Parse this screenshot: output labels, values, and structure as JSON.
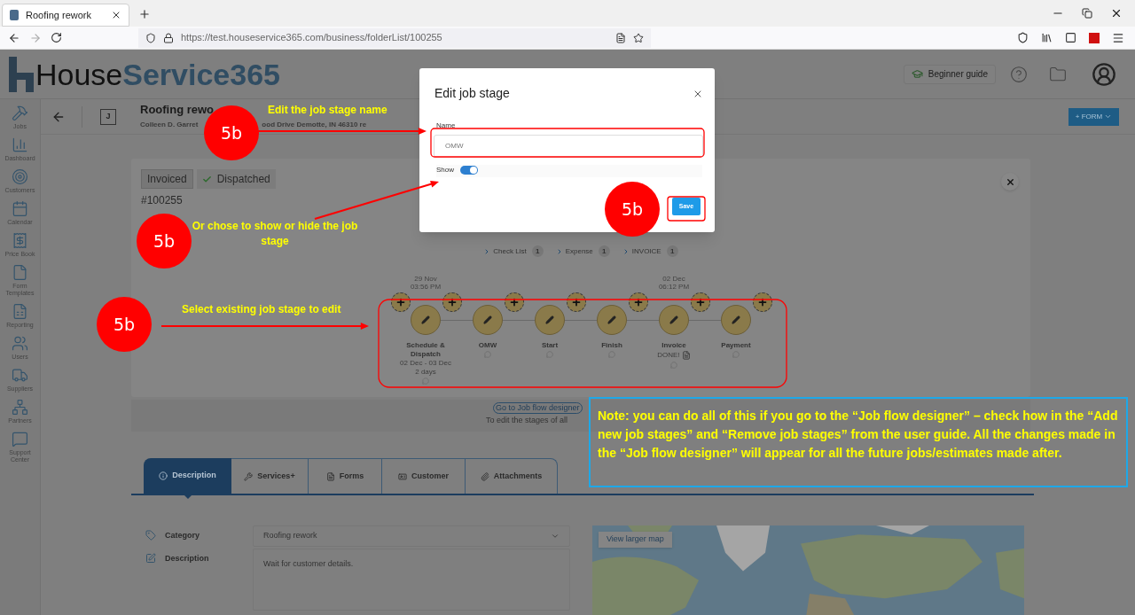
{
  "browser": {
    "tab_title": "Roofing rework",
    "url": "https://test.houseservice365.com/business/folderList/100255"
  },
  "app_header": {
    "logo_left": "House",
    "logo_right": "Service365",
    "guide_button": "Beginner guide"
  },
  "sidebar": {
    "items": [
      {
        "label": "Jobs"
      },
      {
        "label": "Dashboard"
      },
      {
        "label": "Customers"
      },
      {
        "label": "Calendar"
      },
      {
        "label": "Price Book"
      },
      {
        "label": "Form Templates"
      },
      {
        "label": "Reporting"
      },
      {
        "label": "Users"
      },
      {
        "label": "Suppliers"
      },
      {
        "label": "Partners"
      },
      {
        "label": "Support Center"
      }
    ]
  },
  "job_header": {
    "avatar": "J",
    "title": "Roofing rewo",
    "customer": "Colleen D. Garret",
    "address": "ood Drive Demotte, IN 46310 re",
    "form_button": "+ FORM"
  },
  "status_tags": [
    {
      "label": "Invoiced",
      "checked": false
    },
    {
      "label": "Dispatched",
      "checked": true
    }
  ],
  "job_number": "#100255",
  "links": [
    {
      "label": "Check List",
      "count": "1"
    },
    {
      "label": "Expense",
      "count": "1"
    },
    {
      "label": "INVOICE",
      "count": "1"
    }
  ],
  "stages": [
    {
      "name": "Schedule & Dispatch",
      "details": [
        "02 Dec - 03 Dec",
        "2 days"
      ],
      "time": [
        "29 Nov",
        "03:56 PM"
      ]
    },
    {
      "name": "OMW"
    },
    {
      "name": "Start"
    },
    {
      "name": "Finish"
    },
    {
      "name": "Invoice",
      "done": "DONE!",
      "time": [
        "02 Dec",
        "06:12 PM"
      ]
    },
    {
      "name": "Payment"
    }
  ],
  "flow_designer": {
    "link": "Go to Job flow designer",
    "hint": "To edit the stages of all"
  },
  "tabs": [
    {
      "label": "Description",
      "selected": true
    },
    {
      "label": "Services+",
      "selected": false
    },
    {
      "label": "Forms",
      "selected": false
    },
    {
      "label": "Customer",
      "selected": false
    },
    {
      "label": "Attachments",
      "selected": false
    }
  ],
  "fields": [
    {
      "kind": "select",
      "label": "Category",
      "value": "Roofing rework"
    },
    {
      "kind": "textarea",
      "label": "Description",
      "value": "Wait for customer details."
    }
  ],
  "map": {
    "button": "View larger map"
  },
  "dialog": {
    "title": "Edit job stage",
    "name_label": "Name",
    "name_value": "OMW",
    "show_label": "Show",
    "show_on": true,
    "save_button": "Save"
  },
  "annotations": {
    "badges": [
      "5b",
      "5b",
      "5b",
      "5b"
    ],
    "labels": [
      "Edit the job stage name",
      "Or chose to show or hide the job stage",
      "Select existing job stage to edit"
    ],
    "note": "Note: you can do all of this if you go to the “Job flow designer” – check how in the “Add new job stages” and “Remove job stages” from the user guide. All the changes made in the “Job flow designer” will appear for all the future jobs/estimates made after."
  }
}
